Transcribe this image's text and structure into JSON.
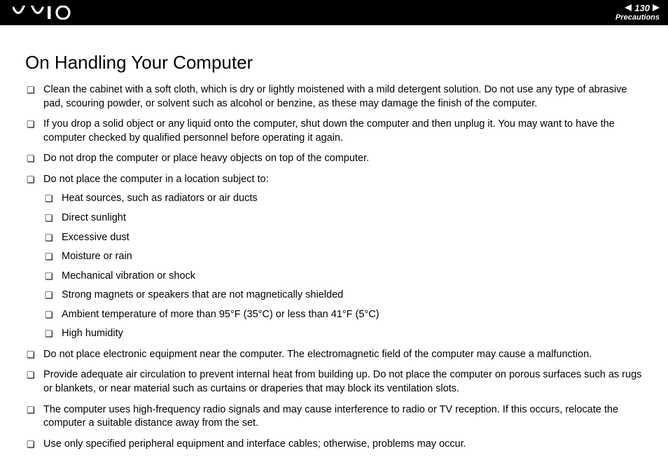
{
  "header": {
    "page_number": "130",
    "section": "Precautions"
  },
  "title": "On Handling Your Computer",
  "items": [
    "Clean the cabinet with a soft cloth, which is dry or lightly moistened with a mild detergent solution. Do not use any type of abrasive pad, scouring powder, or solvent such as alcohol or benzine, as these may damage the finish of the computer.",
    "If you drop a solid object or any liquid onto the computer, shut down the computer and then unplug it. You may want to have the computer checked by qualified personnel before operating it again.",
    "Do not drop the computer or place heavy objects on top of the computer.",
    "Do not place the computer in a location subject to:",
    "Do not place electronic equipment near the computer. The electromagnetic field of the computer may cause a malfunction.",
    "Provide adequate air circulation to prevent internal heat from building up. Do not place the computer on porous surfaces such as rugs or blankets, or near material such as curtains or draperies that may block its ventilation slots.",
    "The computer uses high-frequency radio signals and may cause interference to radio or TV reception. If this occurs, relocate the computer a suitable distance away from the set.",
    "Use only specified peripheral equipment and interface cables; otherwise, problems may occur."
  ],
  "subitems": [
    "Heat sources, such as radiators or air ducts",
    "Direct sunlight",
    "Excessive dust",
    "Moisture or rain",
    "Mechanical vibration or shock",
    "Strong magnets or speakers that are not magnetically shielded",
    "Ambient temperature of more than 95°F (35°C) or less than 41°F (5°C)",
    "High humidity"
  ]
}
